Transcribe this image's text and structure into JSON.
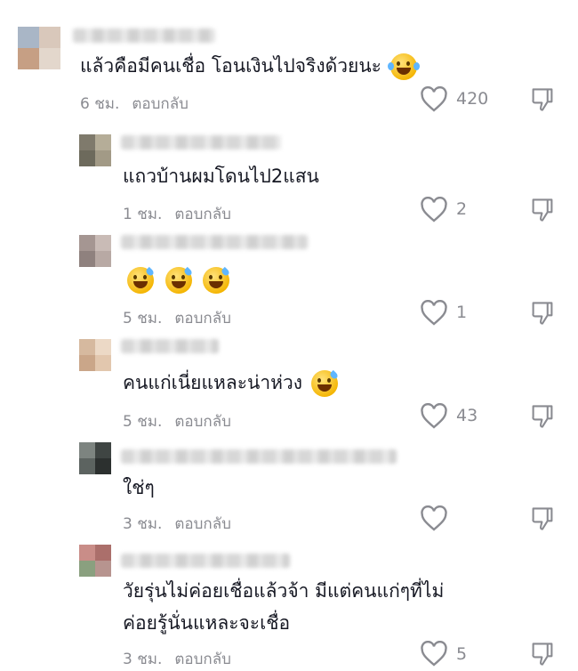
{
  "comments": [
    {
      "avatar_colors": [
        "#a9b6c6",
        "#d9c8bb",
        "#c69f84",
        "#e3d7cc"
      ],
      "text": "แล้วคือมีคนเชื่อ โอนเงินไปจริงด้วยนะ",
      "emoji": [
        "joy-emoji"
      ],
      "time": "6 ชม.",
      "reply": "ตอบกลับ",
      "likes": "420"
    },
    {
      "avatar_colors": [
        "#7f7a6c",
        "#b5ad98",
        "#6d6a5c",
        "#a29a86"
      ],
      "text": "แถวบ้านผมโดนไป2แสน",
      "emoji": [],
      "time": "1 ชม.",
      "reply": "ตอบกลับ",
      "likes": "2"
    },
    {
      "avatar_colors": [
        "#a59692",
        "#c9bbb6",
        "#8f817e",
        "#b8a9a4"
      ],
      "text": "",
      "emoji": [
        "sweat-smile-emoji",
        "sweat-smile-emoji",
        "sweat-smile-emoji"
      ],
      "time": "5 ชม.",
      "reply": "ตอบกลับ",
      "likes": "1"
    },
    {
      "avatar_colors": [
        "#d6b99f",
        "#ecd9c6",
        "#caa689",
        "#e2c7ae"
      ],
      "text": "คนแก่เนี่ยแหละน่าห่วง",
      "emoji": [
        "sweat-smile-emoji"
      ],
      "time": "5 ชม.",
      "reply": "ตอบกลับ",
      "likes": "43"
    },
    {
      "avatar_colors": [
        "#7d8480",
        "#3f4543",
        "#5c6360",
        "#2c302f"
      ],
      "text": "ใช่ๆ",
      "emoji": [],
      "time": "3 ชม.",
      "reply": "ตอบกลับ",
      "likes": ""
    },
    {
      "avatar_colors": [
        "#c98d88",
        "#ab6f6b",
        "#8aa07f",
        "#b7948f"
      ],
      "text_line1": "วัยรุ่นไม่ค่อยเชื่อแล้วจ้า มีแต่คนแก่ๆที่ไม่",
      "text_line2": "ค่อยรู้นั่นแหละจะเชื่อ",
      "emoji": [],
      "time": "3 ชม.",
      "reply": "ตอบกลับ",
      "likes": "5"
    }
  ],
  "icons": {
    "like": "heart-outline-icon",
    "dislike": "thumbs-down-icon"
  },
  "colors": {
    "text": "#161823",
    "meta": "#8a8b91"
  }
}
